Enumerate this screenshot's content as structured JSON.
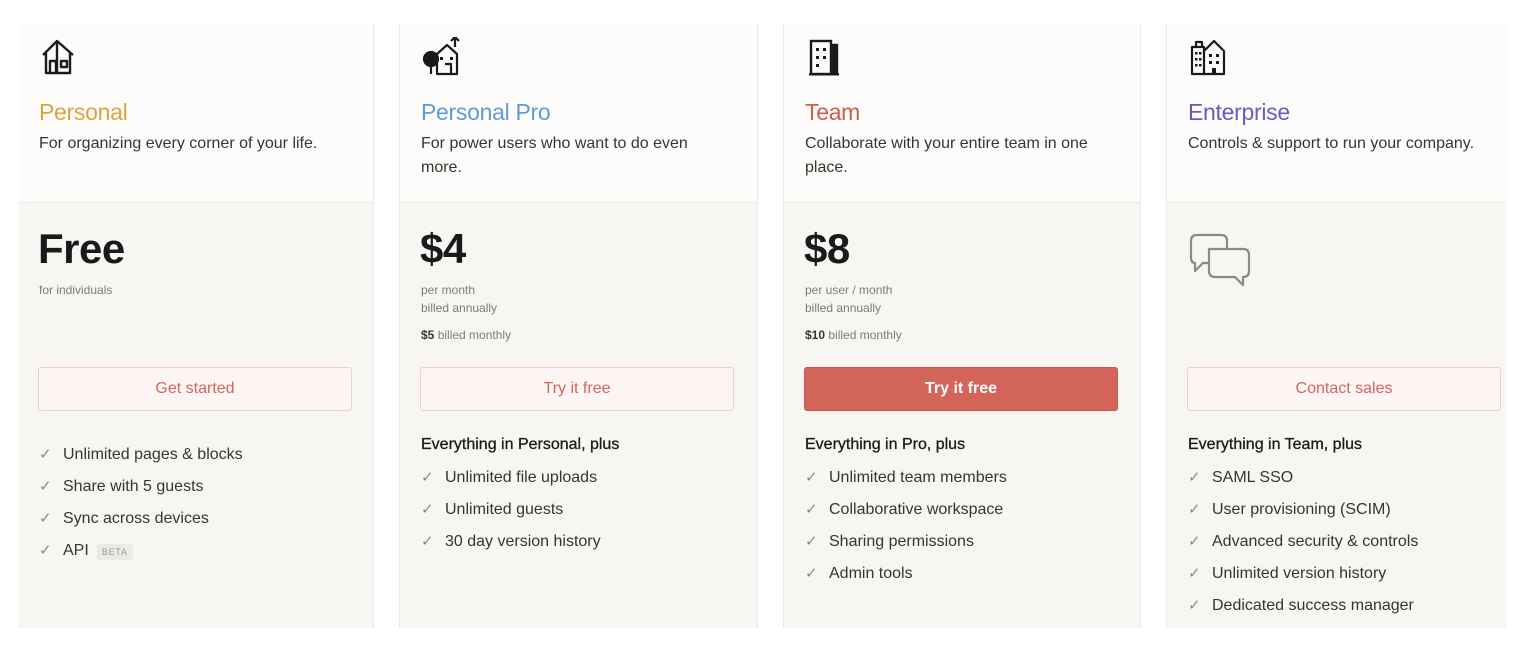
{
  "plans": [
    {
      "name": "Personal",
      "color": "#d9a441",
      "icon": "house-icon",
      "description": "For organizing every corner of your life.",
      "price": "Free",
      "price_sub_1": "for individuals",
      "button": "Get started",
      "features": [
        "Unlimited pages & blocks",
        "Share with 5 guests",
        "Sync across devices",
        "API"
      ],
      "badge": "BETA"
    },
    {
      "name": "Personal Pro",
      "color": "#5d9cd6",
      "icon": "house-with-tree-icon",
      "description": "For power users who want to do even more.",
      "price": "$4",
      "price_sub_1": "per month",
      "price_sub_2": "billed annually",
      "monthly_amount": "$5",
      "monthly_text": " billed monthly",
      "button": "Try it free",
      "features_heading": "Everything in Personal, plus",
      "features": [
        "Unlimited file uploads",
        "Unlimited guests",
        "30 day version history"
      ]
    },
    {
      "name": "Team",
      "color": "#d25a4f",
      "icon": "office-building-icon",
      "description": "Collaborate with your entire team in one place.",
      "price": "$8",
      "price_sub_1": "per user / month",
      "price_sub_2": "billed annually",
      "monthly_amount": "$10",
      "monthly_text": " billed monthly",
      "button": "Try it free",
      "features_heading": "Everything in Pro, plus",
      "features": [
        "Unlimited team members",
        "Collaborative workspace",
        "Sharing permissions",
        "Admin tools"
      ]
    },
    {
      "name": "Enterprise",
      "color": "#6a5ac9",
      "icon": "city-buildings-icon",
      "description": "Controls & support to run your company.",
      "price_icon": "chat-bubbles-icon",
      "button": "Contact sales",
      "features_heading": "Everything in Team, plus",
      "features": [
        "SAML SSO",
        "User provisioning (SCIM)",
        "Advanced security & controls",
        "Unlimited version history",
        "Dedicated success manager"
      ]
    }
  ],
  "check_glyph": "✓"
}
